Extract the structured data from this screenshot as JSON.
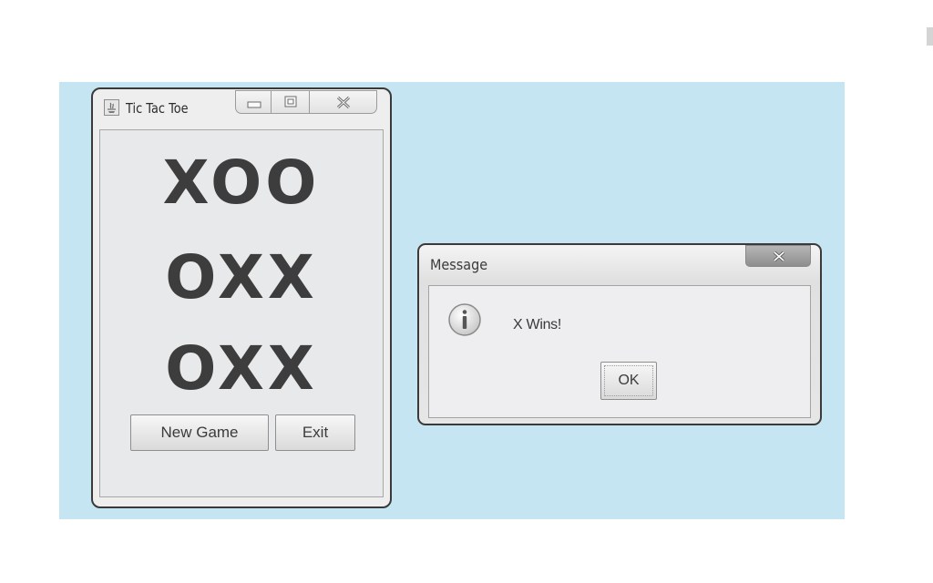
{
  "tic_tac_toe": {
    "title": "Tic Tac Toe",
    "board_rows": [
      "XOO",
      "OXX",
      "OXX"
    ],
    "buttons": {
      "new_game": "New Game",
      "exit": "Exit"
    }
  },
  "message_dialog": {
    "title": "Message",
    "text": "X Wins!",
    "ok_label": "OK",
    "icon": "info-icon"
  },
  "colors": {
    "desktop": "#c6e5f3",
    "window": "#eeeeee",
    "board_text": "#3d3d3d"
  }
}
